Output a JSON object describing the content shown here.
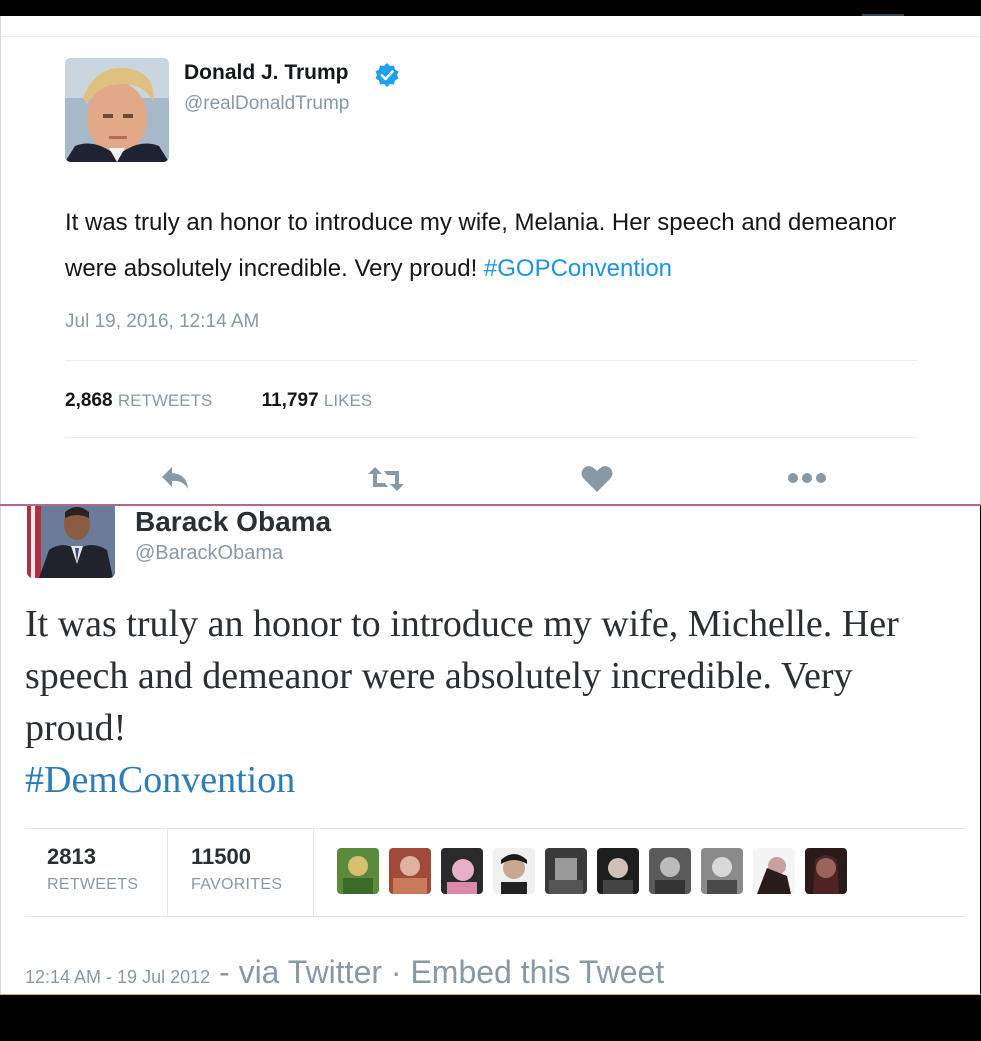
{
  "tweet1": {
    "name": "Donald J. Trump",
    "handle": "@realDonaldTrump",
    "verified": true,
    "text": "It was truly an honor to introduce my wife, Melania. Her speech and demeanor were absolutely incredible. Very proud! ",
    "hashtag": "#GOPConvention",
    "date": "Jul 19, 2016, 12:14 AM",
    "retweets_count": "2,868",
    "retweets_label": "RETWEETS",
    "likes_count": "11,797",
    "likes_label": "LIKES",
    "actions": [
      "reply-icon",
      "retweet-icon",
      "heart-icon",
      "more-icon"
    ],
    "colors": {
      "link": "#1b95e0",
      "verified": "#1da1f2",
      "icon": "#8899a6"
    }
  },
  "tweet2": {
    "name": "Barack Obama",
    "handle": "@BarackObama",
    "text": "It was truly an honor to introduce my wife, Michelle. Her speech and demeanor were absolutely incredible. Very proud!",
    "hashtag": "#DemConvention",
    "retweets_count": "2813",
    "retweets_label": "RETWEETS",
    "favorites_count": "11500",
    "favorites_label": "FAVORITES",
    "footer_time": "12:14 AM - 19 Jul 2012",
    "footer_sep": " - ",
    "footer_via": "via Twitter",
    "footer_dot": " · ",
    "footer_embed": "Embed this Tweet",
    "colors": {
      "link": "#2b7bb9"
    }
  }
}
